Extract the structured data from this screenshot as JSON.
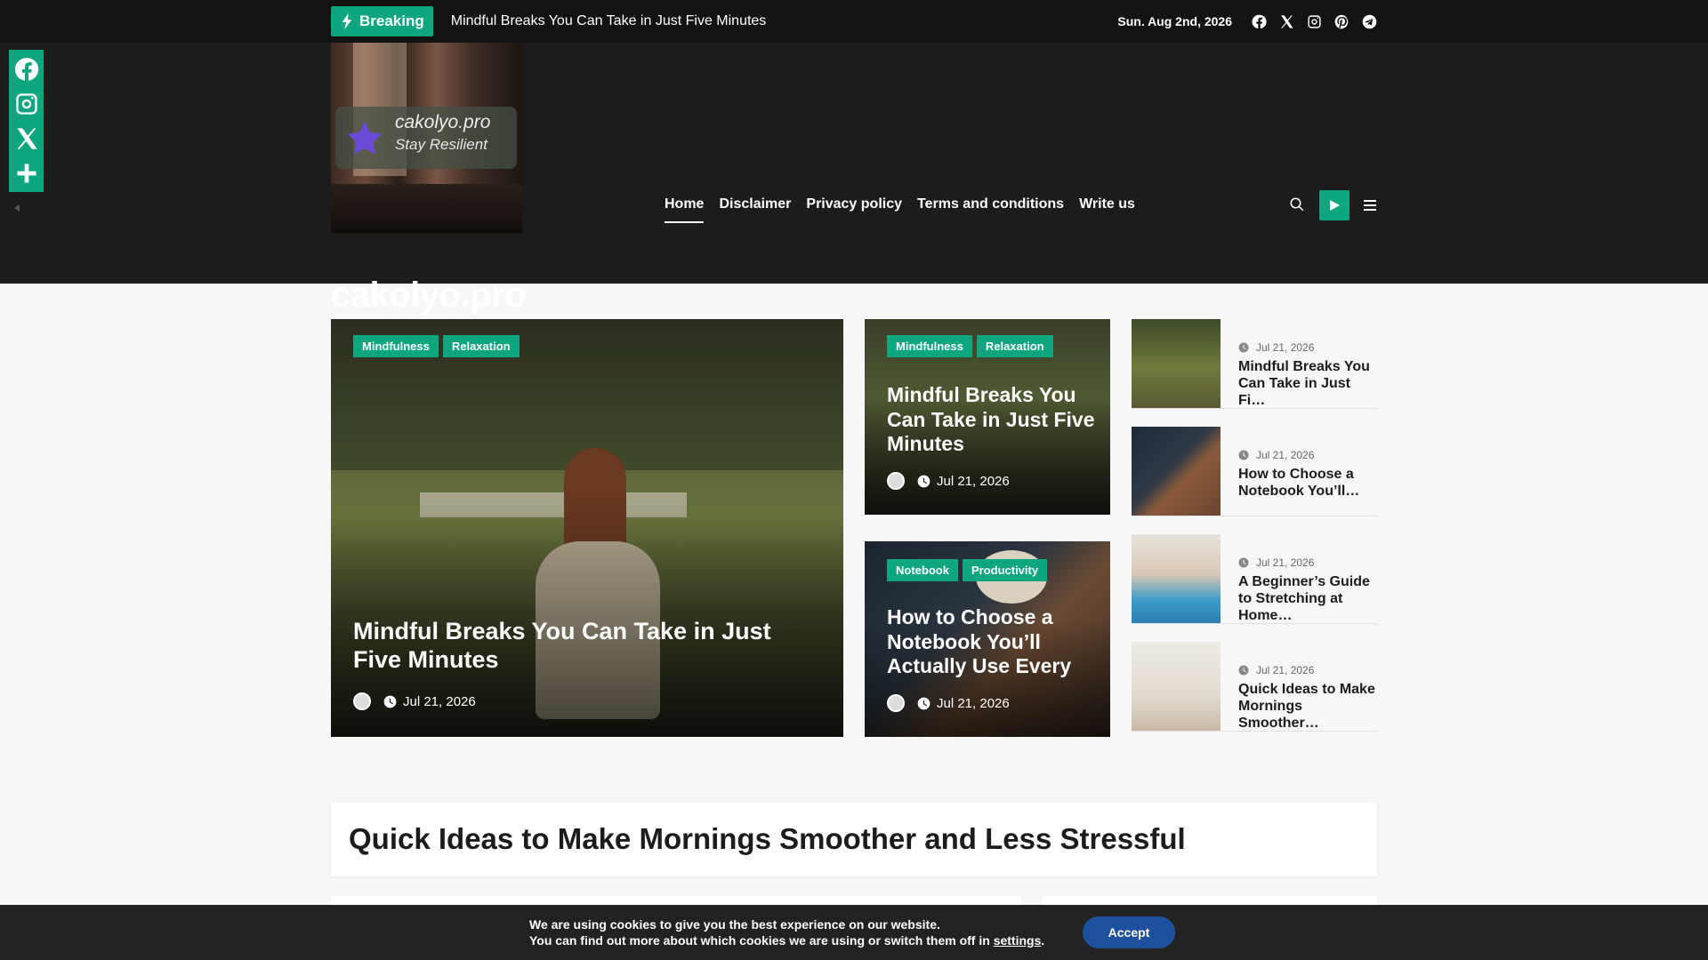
{
  "topbar": {
    "breaking_label": "Breaking",
    "ticker_text": "Mindful Breaks You Can Take in Just Five Minutes",
    "date": "Sun. Aug 2nd, 2026",
    "social_icons": [
      "facebook-icon",
      "x-icon",
      "instagram-icon",
      "pinterest-icon",
      "telegram-icon"
    ]
  },
  "header": {
    "logo_line1": "cakolyo.pro",
    "logo_line2": "Stay Resilient",
    "site_title": "cakolyo.pro",
    "nav": [
      "Home",
      "Disclaimer",
      "Privacy policy",
      "Terms and conditions",
      "Write us"
    ],
    "active_nav": "Home"
  },
  "share_bar": [
    "facebook-icon",
    "instagram-icon",
    "x-icon",
    "plus-icon"
  ],
  "featured": {
    "main": {
      "tags": [
        "Mindfulness",
        "Relaxation"
      ],
      "title": "Mindful Breaks You Can Take in Just Five Minutes",
      "date": "Jul 21, 2026"
    },
    "side1": {
      "tags": [
        "Mindfulness",
        "Relaxation"
      ],
      "title": "Mindful Breaks You Can Take in Just Five Minutes",
      "date": "Jul 21, 2026"
    },
    "side2": {
      "tags": [
        "Notebook",
        "Productivity"
      ],
      "title": "How to Choose a Notebook You’ll Actually Use Every",
      "date": "Jul 21, 2026"
    }
  },
  "sidebar_list": [
    {
      "date": "Jul 21, 2026",
      "title": "Mindful Breaks You Can Take in Just Fi…"
    },
    {
      "date": "Jul 21, 2026",
      "title": "How to Choose a Notebook You’ll…"
    },
    {
      "date": "Jul 21, 2026",
      "title": "A Beginner’s Guide to Stretching at Home…"
    },
    {
      "date": "Jul 21, 2026",
      "title": "Quick Ideas to Make Mornings Smoother…"
    }
  ],
  "section": {
    "heading": "Quick Ideas to Make Mornings Smoother and Less Stressful"
  },
  "cookie": {
    "line1": "We are using cookies to give you the best experience on our website.",
    "line2_prefix": "You can find out more about which cookies we are using or switch them off in ",
    "settings_link": "settings",
    "line2_suffix": ".",
    "accept": "Accept"
  },
  "colors": {
    "accent": "#0ea67e",
    "topbar_bg": "#131313",
    "header_bg": "#1c1c1c",
    "accept_button": "#1e50a0"
  }
}
